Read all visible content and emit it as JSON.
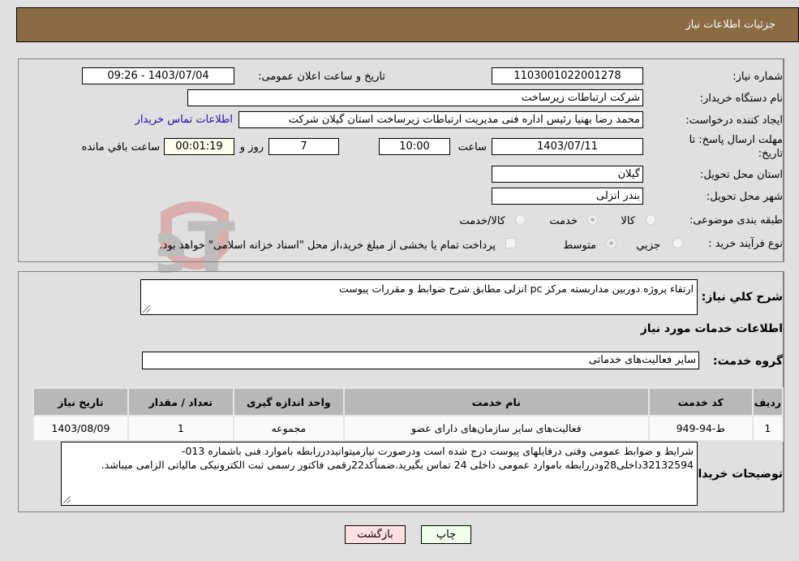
{
  "header": {
    "title": "جزئیات اطلاعات نیاز"
  },
  "fields": {
    "need_number_label": "شماره نیاز:",
    "need_number": "1103001022001278",
    "announce_label": "تاریخ و ساعت اعلان عمومی:",
    "announce_value": "1403/07/04 - 09:26",
    "buyer_org_label": "نام دستگاه خریدار:",
    "buyer_org": "شرکت ارتباطات زیرساخت",
    "creator_label": "ایجاد کننده درخواست:",
    "creator": "محمد رضا بهنیا رئیس اداره فنی مدیریت ارتباطات زیرساخت استان گیلان شرکت",
    "buyer_contact_link": "اطلاعات تماس خریدار",
    "deadline_label_line1": "مهلت ارسال پاسخ: تا",
    "deadline_label_line2": "تاریخ:",
    "deadline_date": "1403/07/11",
    "time_label": "ساعت",
    "deadline_time": "10:00",
    "days": "7",
    "days_label": "روز و",
    "remaining_time": "00:01:19",
    "remaining_label": "ساعت باقي مانده",
    "province_label": "استان محل تحویل:",
    "province": "گیلان",
    "city_label": "شهر محل تحویل:",
    "city": "بندر انزلی",
    "category_label": "طبقه بندی موضوعی:",
    "category_options": [
      {
        "label": "کالا",
        "checked": false
      },
      {
        "label": "خدمت",
        "checked": true
      },
      {
        "label": "کالا/خدمت",
        "checked": false
      }
    ],
    "process_label": "نوع فرآیند خرید :",
    "process_options": [
      {
        "label": "جزيي",
        "checked": false
      },
      {
        "label": "متوسط",
        "checked": true
      }
    ],
    "treasury_checkbox_label": "پرداخت تمام یا بخشی از مبلغ خرید،از محل \"اسناد خزانه اسلامی\" خواهد بود.",
    "treasury_checked": false
  },
  "description": {
    "label": "شرح کلي نیاز:",
    "value": "ارتقاء پروژه دوربین مداربسته مرکز pc انزلی مطابق شرح ضوابط و مقررات پیوست"
  },
  "services_section": {
    "title": "اطلاعات خدمات مورد نیاز",
    "group_label": "گروه خدمت:",
    "group_value": "سایر فعالیت‌های خدماتی"
  },
  "table": {
    "headers": [
      "ردیف",
      "کد خدمت",
      "نام خدمت",
      "واحد اندازه گیری",
      "تعداد / مقدار",
      "تاریخ نیاز"
    ],
    "rows": [
      [
        "1",
        "ط-94-949",
        "فعالیت‌های سایر سازمان‌های دارای عضو",
        "مجموعه",
        "1",
        "1403/08/09"
      ]
    ]
  },
  "buyer_notes": {
    "label": "توضیحات خریدار:",
    "value": "شرایط و ضوابط عمومی وفنی درفایلهای پیوست درج شده است ودرصورت نیازمیتوانیددررابطه باموارد فنی باشماره 013-32132594داخلی28ودررابطه باموارد عمومی داخلی 24 تماس  بگیرید.ضمناًکد22رقمی فاکتور رسمی ثبت الکترونیکی مالیاتی الزامی میباشد."
  },
  "buttons": {
    "print": "چاپ",
    "back": "بازگشت"
  },
  "colors": {
    "header_bg": "#8b6b42",
    "print_bg": "#efffea",
    "back_bg": "#ffe0e0",
    "link": "#1a0dab",
    "remaining_bg": "#ffffee"
  }
}
